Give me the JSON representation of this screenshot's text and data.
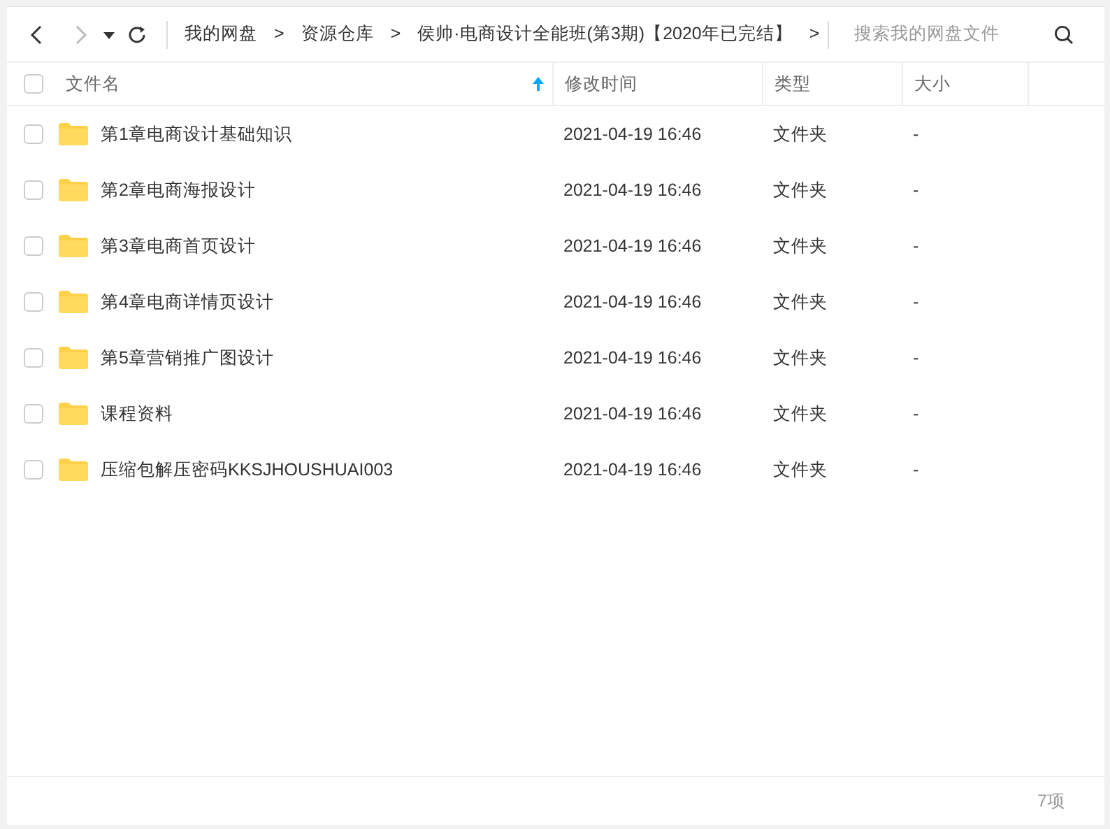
{
  "toolbar": {
    "back": {
      "disabled": false
    },
    "forward": {
      "disabled": true
    },
    "breadcrumb": [
      {
        "label": "我的网盘",
        "separator": ">"
      },
      {
        "label": "资源仓库",
        "separator": ">"
      },
      {
        "label": "侯帅·电商设计全能班(第3期)【2020年已完结】",
        "separator": ">"
      }
    ],
    "search": {
      "placeholder": "搜索我的网盘文件"
    }
  },
  "table": {
    "select_all": {
      "checked": false
    },
    "columns": [
      {
        "label": "文件名",
        "sorted": true
      },
      {
        "label": "修改时间",
        "sorted": false
      },
      {
        "label": "类型",
        "sorted": false
      },
      {
        "label": "大小",
        "sorted": false
      }
    ],
    "rows": [
      {
        "name": "第1章电商设计基础知识",
        "modified": "2021-04-19 16:46",
        "type": "文件夹",
        "size": "-",
        "checked": false
      },
      {
        "name": "第2章电商海报设计",
        "modified": "2021-04-19 16:46",
        "type": "文件夹",
        "size": "-",
        "checked": false
      },
      {
        "name": "第3章电商首页设计",
        "modified": "2021-04-19 16:46",
        "type": "文件夹",
        "size": "-",
        "checked": false
      },
      {
        "name": "第4章电商详情页设计",
        "modified": "2021-04-19 16:46",
        "type": "文件夹",
        "size": "-",
        "checked": false
      },
      {
        "name": "第5章营销推广图设计",
        "modified": "2021-04-19 16:46",
        "type": "文件夹",
        "size": "-",
        "checked": false
      },
      {
        "name": "课程资料",
        "modified": "2021-04-19 16:46",
        "type": "文件夹",
        "size": "-",
        "checked": false
      },
      {
        "name": "压缩包解压密码KKSJHOUSHUAI003",
        "modified": "2021-04-19 16:46",
        "type": "文件夹",
        "size": "-",
        "checked": false
      }
    ]
  },
  "status_bar": {
    "count": "7项"
  }
}
